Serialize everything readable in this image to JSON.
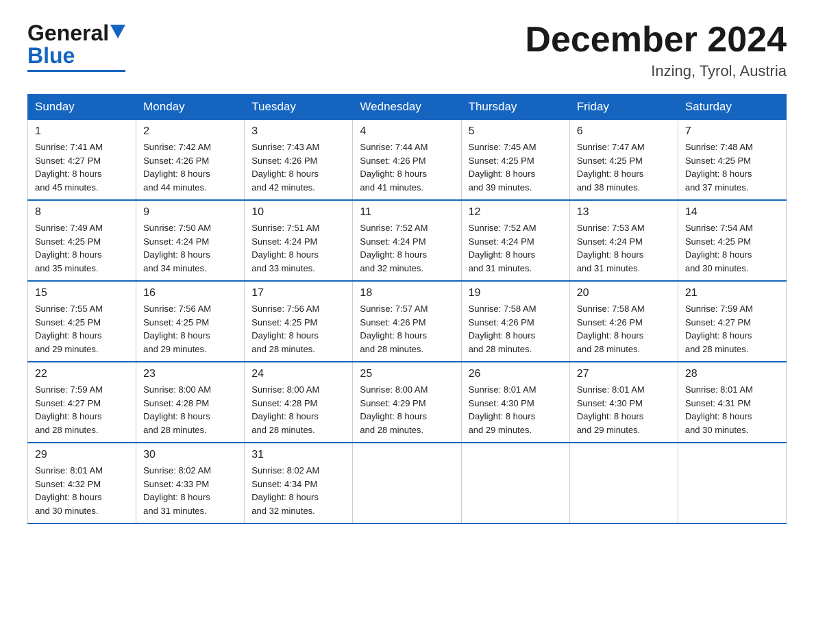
{
  "header": {
    "logo_general": "General",
    "logo_blue": "Blue",
    "title": "December 2024",
    "location": "Inzing, Tyrol, Austria"
  },
  "days_of_week": [
    "Sunday",
    "Monday",
    "Tuesday",
    "Wednesday",
    "Thursday",
    "Friday",
    "Saturday"
  ],
  "weeks": [
    [
      {
        "day": "1",
        "sunrise": "7:41 AM",
        "sunset": "4:27 PM",
        "daylight": "8 hours and 45 minutes."
      },
      {
        "day": "2",
        "sunrise": "7:42 AM",
        "sunset": "4:26 PM",
        "daylight": "8 hours and 44 minutes."
      },
      {
        "day": "3",
        "sunrise": "7:43 AM",
        "sunset": "4:26 PM",
        "daylight": "8 hours and 42 minutes."
      },
      {
        "day": "4",
        "sunrise": "7:44 AM",
        "sunset": "4:26 PM",
        "daylight": "8 hours and 41 minutes."
      },
      {
        "day": "5",
        "sunrise": "7:45 AM",
        "sunset": "4:25 PM",
        "daylight": "8 hours and 39 minutes."
      },
      {
        "day": "6",
        "sunrise": "7:47 AM",
        "sunset": "4:25 PM",
        "daylight": "8 hours and 38 minutes."
      },
      {
        "day": "7",
        "sunrise": "7:48 AM",
        "sunset": "4:25 PM",
        "daylight": "8 hours and 37 minutes."
      }
    ],
    [
      {
        "day": "8",
        "sunrise": "7:49 AM",
        "sunset": "4:25 PM",
        "daylight": "8 hours and 35 minutes."
      },
      {
        "day": "9",
        "sunrise": "7:50 AM",
        "sunset": "4:24 PM",
        "daylight": "8 hours and 34 minutes."
      },
      {
        "day": "10",
        "sunrise": "7:51 AM",
        "sunset": "4:24 PM",
        "daylight": "8 hours and 33 minutes."
      },
      {
        "day": "11",
        "sunrise": "7:52 AM",
        "sunset": "4:24 PM",
        "daylight": "8 hours and 32 minutes."
      },
      {
        "day": "12",
        "sunrise": "7:52 AM",
        "sunset": "4:24 PM",
        "daylight": "8 hours and 31 minutes."
      },
      {
        "day": "13",
        "sunrise": "7:53 AM",
        "sunset": "4:24 PM",
        "daylight": "8 hours and 31 minutes."
      },
      {
        "day": "14",
        "sunrise": "7:54 AM",
        "sunset": "4:25 PM",
        "daylight": "8 hours and 30 minutes."
      }
    ],
    [
      {
        "day": "15",
        "sunrise": "7:55 AM",
        "sunset": "4:25 PM",
        "daylight": "8 hours and 29 minutes."
      },
      {
        "day": "16",
        "sunrise": "7:56 AM",
        "sunset": "4:25 PM",
        "daylight": "8 hours and 29 minutes."
      },
      {
        "day": "17",
        "sunrise": "7:56 AM",
        "sunset": "4:25 PM",
        "daylight": "8 hours and 28 minutes."
      },
      {
        "day": "18",
        "sunrise": "7:57 AM",
        "sunset": "4:26 PM",
        "daylight": "8 hours and 28 minutes."
      },
      {
        "day": "19",
        "sunrise": "7:58 AM",
        "sunset": "4:26 PM",
        "daylight": "8 hours and 28 minutes."
      },
      {
        "day": "20",
        "sunrise": "7:58 AM",
        "sunset": "4:26 PM",
        "daylight": "8 hours and 28 minutes."
      },
      {
        "day": "21",
        "sunrise": "7:59 AM",
        "sunset": "4:27 PM",
        "daylight": "8 hours and 28 minutes."
      }
    ],
    [
      {
        "day": "22",
        "sunrise": "7:59 AM",
        "sunset": "4:27 PM",
        "daylight": "8 hours and 28 minutes."
      },
      {
        "day": "23",
        "sunrise": "8:00 AM",
        "sunset": "4:28 PM",
        "daylight": "8 hours and 28 minutes."
      },
      {
        "day": "24",
        "sunrise": "8:00 AM",
        "sunset": "4:28 PM",
        "daylight": "8 hours and 28 minutes."
      },
      {
        "day": "25",
        "sunrise": "8:00 AM",
        "sunset": "4:29 PM",
        "daylight": "8 hours and 28 minutes."
      },
      {
        "day": "26",
        "sunrise": "8:01 AM",
        "sunset": "4:30 PM",
        "daylight": "8 hours and 29 minutes."
      },
      {
        "day": "27",
        "sunrise": "8:01 AM",
        "sunset": "4:30 PM",
        "daylight": "8 hours and 29 minutes."
      },
      {
        "day": "28",
        "sunrise": "8:01 AM",
        "sunset": "4:31 PM",
        "daylight": "8 hours and 30 minutes."
      }
    ],
    [
      {
        "day": "29",
        "sunrise": "8:01 AM",
        "sunset": "4:32 PM",
        "daylight": "8 hours and 30 minutes."
      },
      {
        "day": "30",
        "sunrise": "8:02 AM",
        "sunset": "4:33 PM",
        "daylight": "8 hours and 31 minutes."
      },
      {
        "day": "31",
        "sunrise": "8:02 AM",
        "sunset": "4:34 PM",
        "daylight": "8 hours and 32 minutes."
      },
      null,
      null,
      null,
      null
    ]
  ],
  "labels": {
    "sunrise": "Sunrise:",
    "sunset": "Sunset:",
    "daylight": "Daylight:"
  }
}
